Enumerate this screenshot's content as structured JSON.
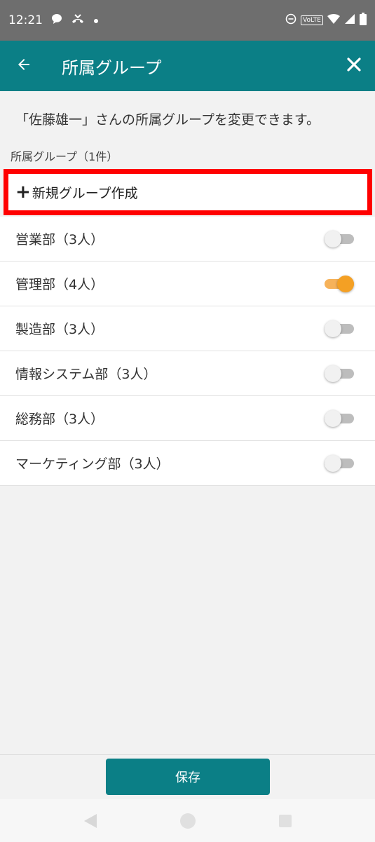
{
  "status_bar": {
    "time": "12:21",
    "left_icons": [
      "chat-bubble-icon",
      "missed-call-icon",
      "dot-icon"
    ],
    "right_icons": [
      "do-not-disturb-icon",
      "volte-icon",
      "wifi-icon",
      "signal-icon",
      "battery-icon"
    ],
    "volte_label": "VoLTE"
  },
  "app_bar": {
    "title": "所属グループ",
    "background": "#0b7f86"
  },
  "description": "「佐藤雄一」さんの所属グループを変更できます。",
  "section_label": "所属グループ（1件）",
  "new_group": {
    "plus": "+",
    "label": "新規グループ作成",
    "highlight_color": "#ff0000"
  },
  "groups": [
    {
      "label": "営業部（3人）",
      "enabled": false
    },
    {
      "label": "管理部（4人）",
      "enabled": true
    },
    {
      "label": "製造部（3人）",
      "enabled": false
    },
    {
      "label": "情報システム部（3人）",
      "enabled": false
    },
    {
      "label": "総務部（3人）",
      "enabled": false
    },
    {
      "label": "マーケティング部（3人）",
      "enabled": false
    }
  ],
  "footer": {
    "save_label": "保存"
  },
  "colors": {
    "accent": "#0b7f86",
    "toggle_on": "#f4a024"
  }
}
